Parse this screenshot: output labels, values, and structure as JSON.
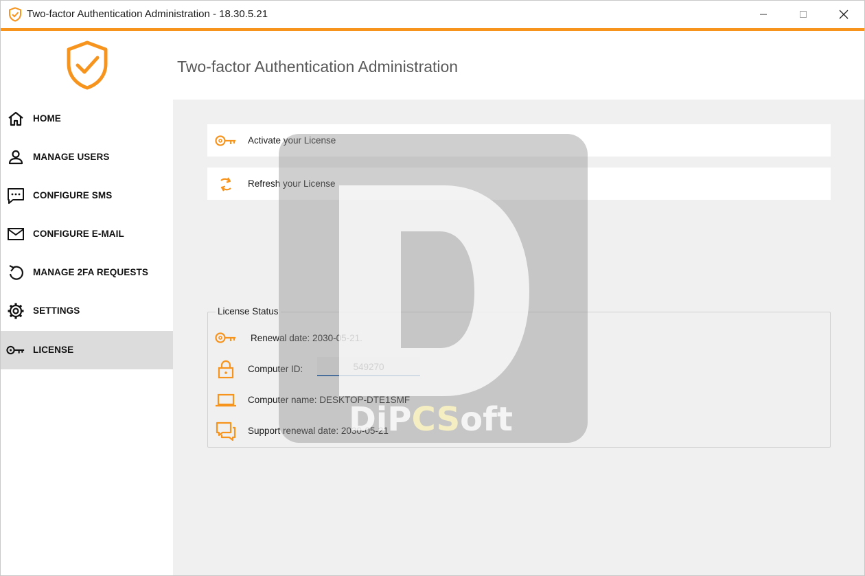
{
  "window": {
    "title": "Two-factor Authentication Administration - 18.30.5.21",
    "accent_color": "#f7941d"
  },
  "header": {
    "title": "Two-factor Authentication Administration",
    "logo_icon": "shield-check-icon"
  },
  "sidebar": {
    "items": [
      {
        "label": "HOME",
        "icon": "home-icon",
        "active": false
      },
      {
        "label": "MANAGE USERS",
        "icon": "user-icon",
        "active": false
      },
      {
        "label": "CONFIGURE SMS",
        "icon": "chat-icon",
        "active": false
      },
      {
        "label": "CONFIGURE E-MAIL",
        "icon": "mail-icon",
        "active": false
      },
      {
        "label": "MANAGE 2FA REQUESTS",
        "icon": "undo-icon",
        "active": false
      },
      {
        "label": "SETTINGS",
        "icon": "gear-icon",
        "active": false
      },
      {
        "label": "LICENSE",
        "icon": "key-icon",
        "active": true
      }
    ]
  },
  "actions": {
    "activate_label": "Activate your License",
    "refresh_label": "Refresh your License"
  },
  "license_status": {
    "legend": "License Status",
    "renewal": "Renewal date: 2030-05-21.",
    "computer_id_label": "Computer ID:",
    "computer_id_value": "549270",
    "computer_name": "Computer name: DESKTOP-DTE1SMF",
    "support_renewal": "Support renewal date: 2030-05-21"
  },
  "watermark": {
    "text_di": "DiP",
    "text_cs": "CS",
    "text_oft": "oft"
  }
}
